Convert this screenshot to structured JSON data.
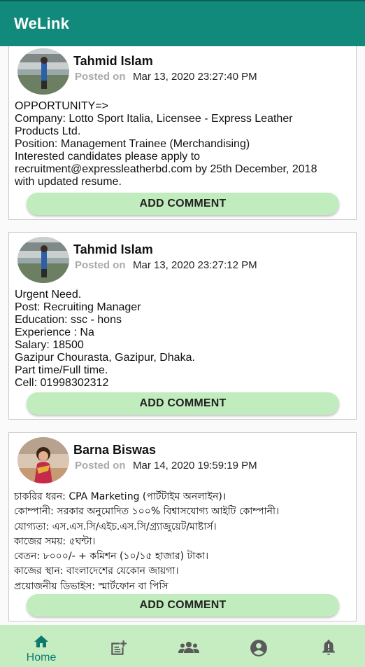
{
  "app": {
    "title": "WeLink"
  },
  "posts": [
    {
      "author": "Tahmid Islam",
      "posted_label": "Posted on",
      "date": "Mar 13, 2020  23:27:40 PM",
      "body": "OPPORTUNITY=>\nCompany: Lotto Sport Italia, Licensee - Express Leather\nProducts Ltd.\nPosition: Management Trainee (Merchandising)\nInterested candidates please apply to\nrecruitment@expressleatherbd.com by 25th December, 2018\nwith updated resume.",
      "comment_label": "ADD COMMENT"
    },
    {
      "author": "Tahmid Islam",
      "posted_label": "Posted on",
      "date": "Mar 13, 2020  23:27:12 PM",
      "body": "Urgent Need.\nPost: Recruiting Manager\nEducation: ssc - hons\nExperience : Na\nSalary: 18500\nGazipur Chourasta, Gazipur, Dhaka.\nPart time/Full time.\nCell: 01998302312",
      "comment_label": "ADD COMMENT"
    },
    {
      "author": "Barna Biswas",
      "posted_label": "Posted on",
      "date": "Mar 14, 2020  19:59:19 PM",
      "body": "চাকরির ধরন: CPA Marketing (পার্টটাইম অনলাইন)।\nকোম্পানী: সরকার অনুমোদিত ১০০% বিশ্বাসযোগ্য আইটি কোম্পানী।\nযোগ্যতা: এস.এস.সি/এইচ.এস.সি/গ্র্যাজুয়েট/মাষ্টার্স।\nকাজের সময়: ৫ঘন্টা।\nবেতন: ৮০০০/- + কমিশন (১০/১৫ হাজার) টাকা।\nকাজের স্থান: বাংলাদেশের যেকোন জায়গা।\nপ্রয়োজনীয় ডিভাইস: স্মার্টফোন বা পিসি",
      "comment_label": "ADD COMMENT"
    }
  ],
  "bottom_nav": {
    "home_label": "Home",
    "items": [
      "home-icon",
      "new-post-icon",
      "groups-icon",
      "profile-icon",
      "notification-icon"
    ],
    "active_color": "#0d7a6e",
    "inactive_color": "#5a5a5a"
  },
  "colors": {
    "app_bar": "#118a7b",
    "button": "#c1ecbd",
    "nav_bg": "#c6ecc2"
  }
}
